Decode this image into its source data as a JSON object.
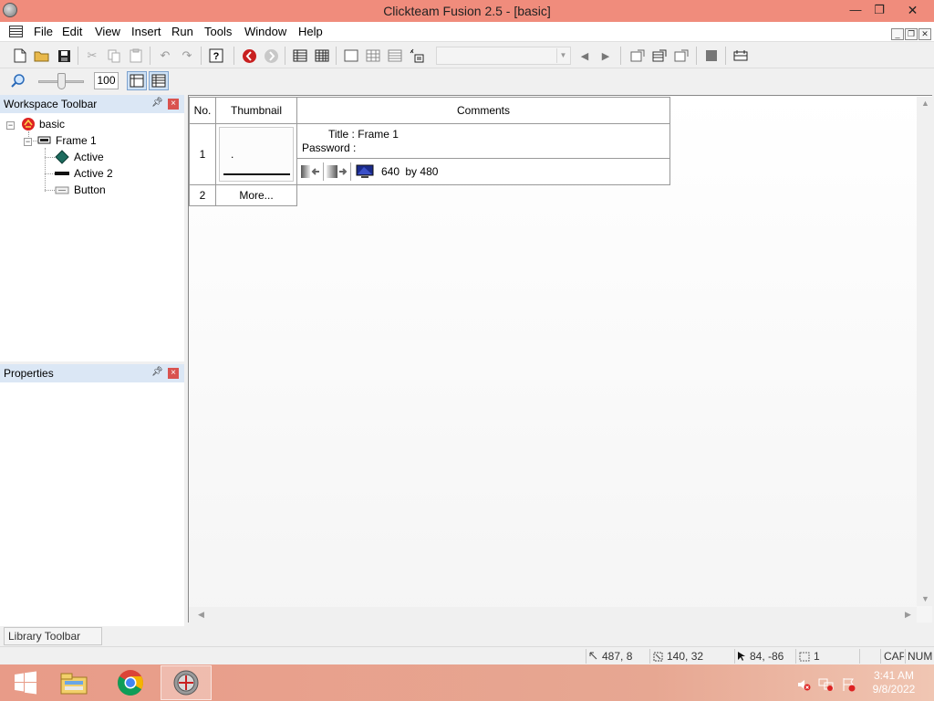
{
  "window": {
    "title": "Clickteam Fusion 2.5 - [basic]",
    "minimize_glyph": "—",
    "maximize_glyph": "❐",
    "close_glyph": "✕"
  },
  "menu": {
    "items": [
      "File",
      "Edit",
      "View",
      "Insert",
      "Run",
      "Tools",
      "Window",
      "Help"
    ]
  },
  "zoom": {
    "value": "100",
    "level_percent": 50
  },
  "workspace": {
    "title": "Workspace Toolbar",
    "tree": {
      "root": "basic",
      "frame": "Frame 1",
      "objects": [
        "Active",
        "Active 2",
        "Button"
      ]
    }
  },
  "properties": {
    "title": "Properties"
  },
  "frame_table": {
    "headers": [
      "No.",
      "Thumbnail",
      "Comments"
    ],
    "rows": [
      {
        "number": "1",
        "thumbnail_text": ".",
        "title_label": "Title :",
        "title_value": "Frame 1",
        "password_label": "Password :",
        "password_value": "",
        "width": "640",
        "by": "by",
        "height": "480"
      },
      {
        "number": "2",
        "more": "More..."
      }
    ]
  },
  "library": {
    "label": "Library Toolbar"
  },
  "status": {
    "cursor_pos": "487, 8",
    "size": "140, 32",
    "mouse_pos": "84, -86",
    "selection_count": "1",
    "caps": "CAP",
    "num": "NUM"
  },
  "taskbar": {
    "time": "3:41 AM",
    "date": "9/8/2022"
  },
  "colors": {
    "titlebar": "#f08c7c",
    "panel_header": "#dbe7f5",
    "close_red": "#d9534f",
    "taskbar": "#e89b88"
  }
}
